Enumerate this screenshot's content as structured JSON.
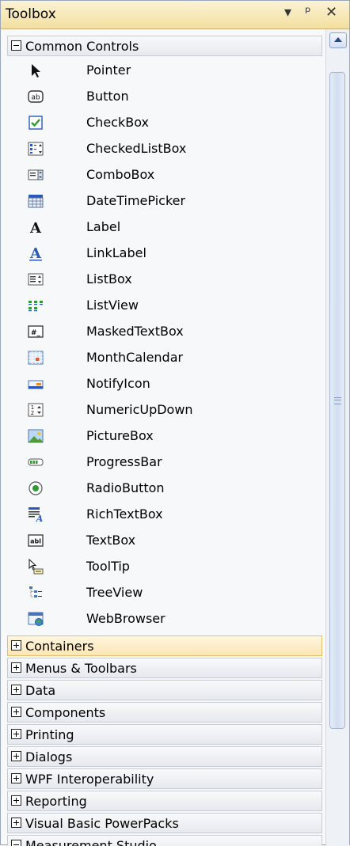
{
  "toolbox": {
    "title": "Toolbox",
    "buttons": {
      "dropdown": "▾",
      "pin": "ᵖ",
      "close": "✕"
    }
  },
  "categories": [
    {
      "label": "Common Controls",
      "expanded": true
    },
    {
      "label": "Containers",
      "expanded": false,
      "selected": true
    },
    {
      "label": "Menus & Toolbars",
      "expanded": false
    },
    {
      "label": "Data",
      "expanded": false
    },
    {
      "label": "Components",
      "expanded": false
    },
    {
      "label": "Printing",
      "expanded": false
    },
    {
      "label": "Dialogs",
      "expanded": false
    },
    {
      "label": "WPF Interoperability",
      "expanded": false
    },
    {
      "label": "Reporting",
      "expanded": false
    },
    {
      "label": "Visual Basic PowerPacks",
      "expanded": false
    },
    {
      "label": "Measurement Studio",
      "expanded": true
    }
  ],
  "common_controls": [
    {
      "label": "Pointer",
      "icon": "pointer-icon"
    },
    {
      "label": "Button",
      "icon": "button-icon"
    },
    {
      "label": "CheckBox",
      "icon": "checkbox-icon"
    },
    {
      "label": "CheckedListBox",
      "icon": "checkedlistbox-icon"
    },
    {
      "label": "ComboBox",
      "icon": "combobox-icon"
    },
    {
      "label": "DateTimePicker",
      "icon": "datetimepicker-icon"
    },
    {
      "label": "Label",
      "icon": "label-icon"
    },
    {
      "label": "LinkLabel",
      "icon": "linklabel-icon"
    },
    {
      "label": "ListBox",
      "icon": "listbox-icon"
    },
    {
      "label": "ListView",
      "icon": "listview-icon"
    },
    {
      "label": "MaskedTextBox",
      "icon": "maskedtextbox-icon"
    },
    {
      "label": "MonthCalendar",
      "icon": "monthcalendar-icon"
    },
    {
      "label": "NotifyIcon",
      "icon": "notifyicon-icon"
    },
    {
      "label": "NumericUpDown",
      "icon": "numericupdown-icon"
    },
    {
      "label": "PictureBox",
      "icon": "picturebox-icon"
    },
    {
      "label": "ProgressBar",
      "icon": "progressbar-icon"
    },
    {
      "label": "RadioButton",
      "icon": "radiobutton-icon"
    },
    {
      "label": "RichTextBox",
      "icon": "richtextbox-icon"
    },
    {
      "label": "TextBox",
      "icon": "textbox-icon"
    },
    {
      "label": "ToolTip",
      "icon": "tooltip-icon"
    },
    {
      "label": "TreeView",
      "icon": "treeview-icon"
    },
    {
      "label": "WebBrowser",
      "icon": "webbrowser-icon"
    }
  ],
  "icon_text": {
    "button": "ab",
    "textbox": "abl",
    "maskedtextbox": "#_",
    "label": "A",
    "linklabel": "A"
  },
  "colors": {
    "title_bar": "#f3df9e",
    "selected_category": "#fbe6b5",
    "accent_blue": "#2b58b8",
    "checkbox_green": "#2f9a2f"
  }
}
